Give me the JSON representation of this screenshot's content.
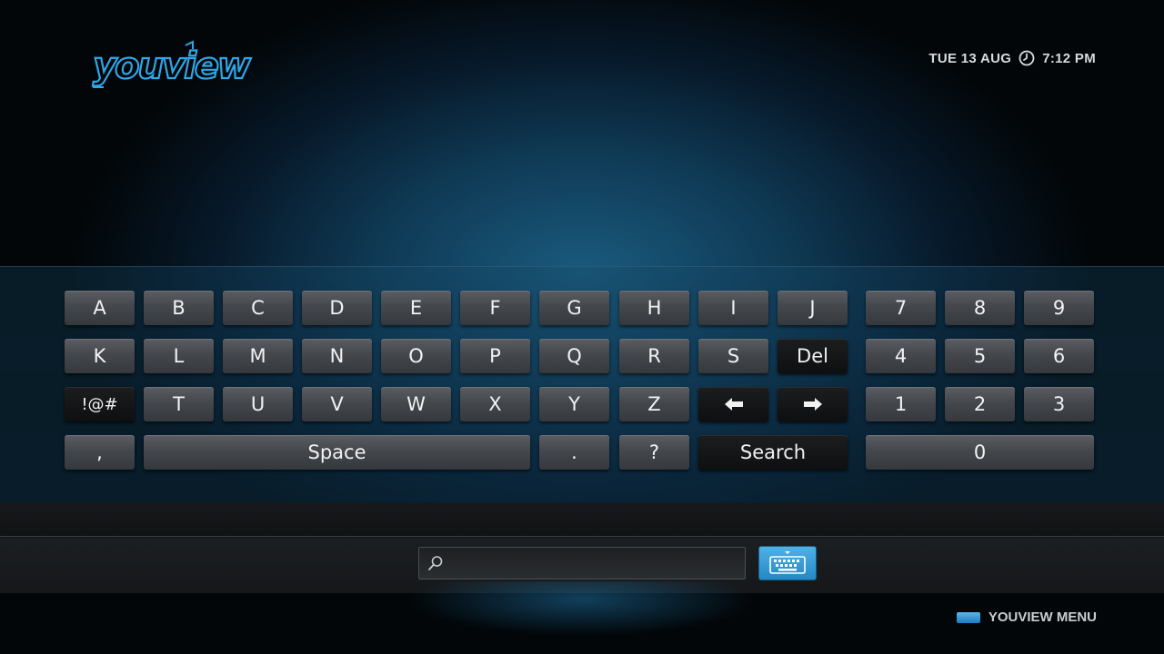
{
  "brand": {
    "logo_text": "youview"
  },
  "header": {
    "date": "TUE 13 AUG",
    "time": "7:12 PM",
    "clock_icon": "clock-icon"
  },
  "keyboard": {
    "letters": [
      "A",
      "B",
      "C",
      "D",
      "E",
      "F",
      "G",
      "H",
      "I",
      "J",
      "K",
      "L",
      "M",
      "N",
      "O",
      "P",
      "Q",
      "R",
      "S"
    ],
    "del_label": "Del",
    "symbols_label": "!@#",
    "letters_row3": [
      "T",
      "U",
      "V",
      "W",
      "X",
      "Y",
      "Z"
    ],
    "left_arrow_icon": "arrow-left-icon",
    "right_arrow_icon": "arrow-right-icon",
    "comma": ",",
    "space_label": "Space",
    "period": ".",
    "question": "?",
    "search_label": "Search",
    "digits_row1": [
      "7",
      "8",
      "9"
    ],
    "digits_row2": [
      "4",
      "5",
      "6"
    ],
    "digits_row3": [
      "1",
      "2",
      "3"
    ],
    "zero": "0"
  },
  "search": {
    "value": "",
    "placeholder": "",
    "icon": "search-icon",
    "keyboard_toggle_icon": "keyboard-icon"
  },
  "footer": {
    "menu_label": "YOUVIEW MENU",
    "button_color": "#2a8ad0"
  },
  "colors": {
    "accent": "#2a8ad0",
    "logo": "#2fa6e6"
  }
}
